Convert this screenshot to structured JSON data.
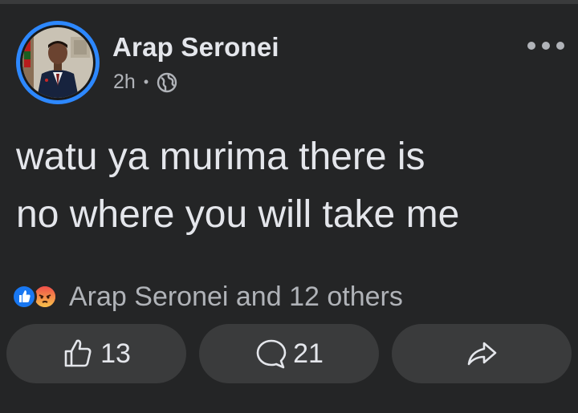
{
  "post": {
    "author": "Arap Seronei",
    "time": "2h",
    "separator": "•",
    "audience_icon": "globe-icon",
    "more_icon": "more-horizontal-icon",
    "text": "watu ya murima there is\nno where you will take me"
  },
  "reactions": {
    "icons": [
      "like-reaction-icon",
      "angry-reaction-icon"
    ],
    "summary": "Arap Seronei and 12 others"
  },
  "actions": {
    "like_count": "13",
    "comment_count": "21",
    "share_icon": "share-icon"
  },
  "colors": {
    "background": "#242526",
    "button": "#3a3b3c",
    "text_primary": "#e4e6eb",
    "text_secondary": "#b0b3b8",
    "avatar_ring": "#2d88ff",
    "like_blue": "#1877f2",
    "angry_red": "#f33e58"
  }
}
